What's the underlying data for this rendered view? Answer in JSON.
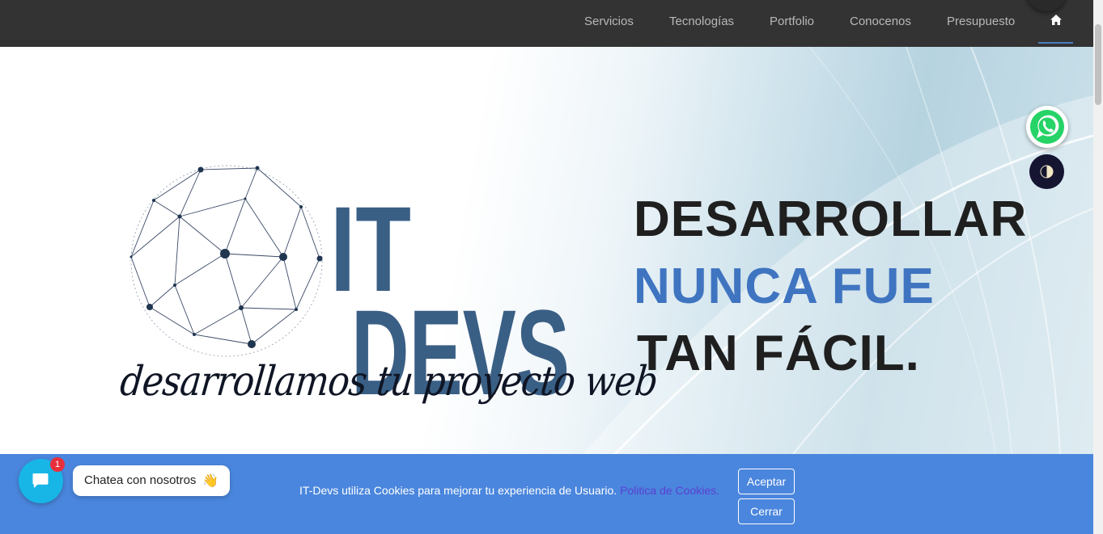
{
  "nav": {
    "items": [
      {
        "label": "Servicios"
      },
      {
        "label": "Tecnologías"
      },
      {
        "label": "Portfolio"
      },
      {
        "label": "Conocenos"
      },
      {
        "label": "Presupuesto"
      }
    ],
    "home_icon": "home-icon"
  },
  "hero": {
    "logo": {
      "text_top": "IT",
      "text_bottom": "DEVS",
      "icon": "globe-network-icon"
    },
    "tagline": "desarrollamos tu proyecto web",
    "headline": {
      "line1": "DESARROLLAR",
      "line2": "NUNCA FUE",
      "line3": "TAN FÁCIL."
    }
  },
  "floating": {
    "whatsapp_icon": "whatsapp-icon",
    "theme_icon": "contrast-icon"
  },
  "cookie_bar": {
    "message": "IT-Devs utiliza Cookies para mejorar tu experiencia de Usuario.",
    "link_text": "Politica de Cookies.",
    "accept_label": "Aceptar",
    "close_label": "Cerrar"
  },
  "chat": {
    "badge_count": "1",
    "bubble_text": "Chatea con nosotros",
    "wave_emoji": "👋"
  },
  "colors": {
    "navbar": "#333333",
    "accent_blue": "#3f74c0",
    "cookie_bar": "#4a86dd",
    "chat_fab": "#17b6e6",
    "whatsapp": "#25d366"
  }
}
